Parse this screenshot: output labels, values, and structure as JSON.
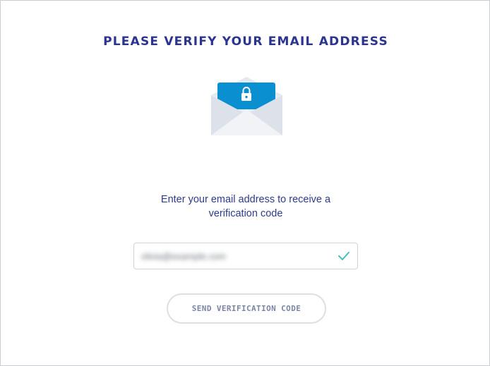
{
  "page": {
    "title": "PLEASE VERIFY YOUR EMAIL ADDRESS",
    "illustration": "envelope-lock-icon",
    "prompt_line1": "Enter your email address to receive a",
    "prompt_line2": "verification code"
  },
  "email_field": {
    "value": "olivia@example.com",
    "value_note_blurred": true,
    "status_icon": "check-icon"
  },
  "actions": {
    "send_label": "SEND VERIFICATION CODE"
  },
  "colors": {
    "title": "#2b3590",
    "text": "#2e3a8c",
    "accent_blue": "#0a8fd1",
    "check_teal": "#3fc1c0",
    "button_text": "#7b86a6",
    "border": "#cfd3da"
  }
}
